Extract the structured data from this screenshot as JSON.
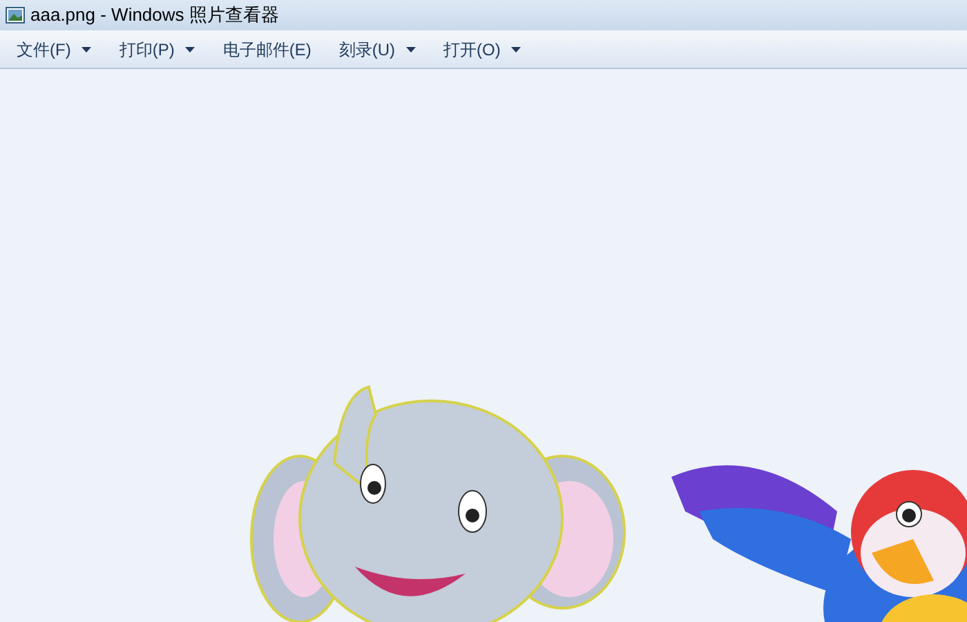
{
  "window": {
    "title": "aaa.png - Windows 照片查看器"
  },
  "menu": [
    {
      "label": "文件(F)",
      "dropdown": true
    },
    {
      "label": "打印(P)",
      "dropdown": true
    },
    {
      "label": "电子邮件(E)",
      "dropdown": false
    },
    {
      "label": "刻录(U)",
      "dropdown": true
    },
    {
      "label": "打开(O)",
      "dropdown": true
    }
  ]
}
